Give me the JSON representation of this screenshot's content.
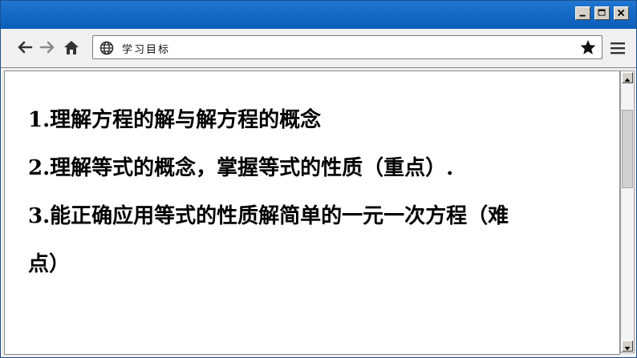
{
  "window": {
    "controls": [
      "minimize",
      "maximize",
      "close"
    ]
  },
  "toolbar": {
    "back_icon": "arrow-left-icon",
    "forward_icon": "arrow-right-icon",
    "home_icon": "home-icon",
    "bookmark_icon": "star-icon",
    "menu_icon": "hamburger-icon"
  },
  "address_bar": {
    "icon": "globe-icon",
    "text": "学习目标"
  },
  "content": {
    "objectives": [
      "1.理解方程的解与解方程的概念",
      "2.理解等式的概念，掌握等式的性质（重点）.",
      "3.能正确应用等式的性质解简单的一元一次方程（难",
      "点）"
    ]
  },
  "colors": {
    "titlebar": "#0b5cb8",
    "window_border": "#1e4f8a",
    "toolbar_bg": "#f0f0f0"
  }
}
